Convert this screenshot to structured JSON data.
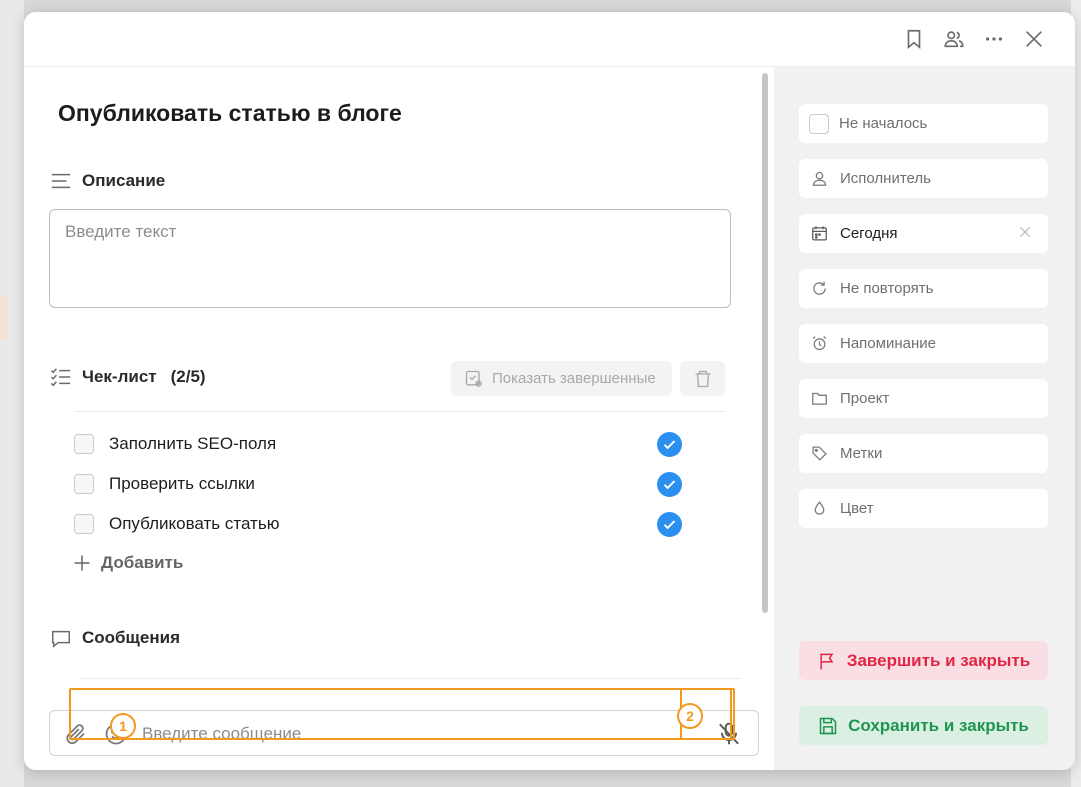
{
  "task": {
    "title": "Опубликовать статью в блоге"
  },
  "description": {
    "label": "Описание",
    "placeholder": "Введите текст"
  },
  "checklist": {
    "label": "Чек-лист",
    "count": "(2/5)",
    "show_done_label": "Показать завершенные",
    "items": [
      {
        "label": "Заполнить SEO-поля"
      },
      {
        "label": "Проверить ссылки"
      },
      {
        "label": "Опубликовать статью"
      }
    ],
    "add_label": "Добавить"
  },
  "messages": {
    "label": "Сообщения",
    "placeholder": "Введите сообщение"
  },
  "annotations": {
    "marker1": "1",
    "marker2": "2",
    "color": "#f39a1e"
  },
  "sidebar": {
    "status": "Не началось",
    "assignee": "Исполнитель",
    "date": "Сегодня",
    "repeat": "Не повторять",
    "reminder": "Напоминание",
    "project": "Проект",
    "tags": "Метки",
    "color": "Цвет"
  },
  "actions": {
    "finish_label": "Завершить и закрыть",
    "save_label": "Сохранить и закрыть"
  },
  "colors": {
    "accent_blue": "#2b8ff0",
    "finish_red": "#e22544",
    "save_green": "#1e9650"
  }
}
